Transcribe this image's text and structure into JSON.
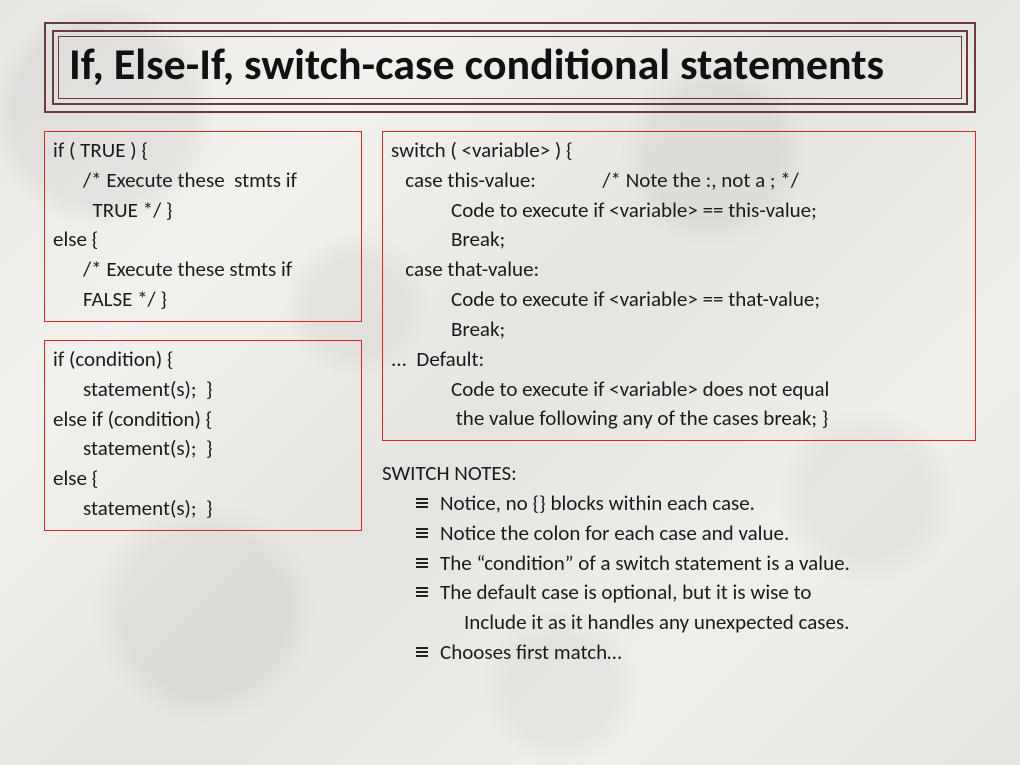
{
  "title": "If, Else-If, switch-case conditional statements",
  "if_block": {
    "l1": "if ( TRUE ) {",
    "l2": "/* Execute these  stmts if",
    "l3": "TRUE */ }",
    "l4": "else {",
    "l5": "/* Execute these stmts if",
    "l6": "FALSE */ }"
  },
  "elseif_block": {
    "l1": "if (condition) {",
    "l2": "statement(s);  }",
    "l3": "else if (condition) {",
    "l4": "statement(s);  }",
    "l5": "else {",
    "l6": "statement(s);  }"
  },
  "switch_block": {
    "l1": "switch ( <variable> ) {",
    "l2": "case this-value:              /* Note the :, not a ; */",
    "l3": "Code to execute if <variable> == this-value;",
    "l4": "Break;",
    "l5": "case that-value:",
    "l6": "Code to execute if <variable> == that-value;",
    "l7": "Break;",
    "l8": "...  Default:",
    "l9": "Code to execute if <variable> does not equal",
    "l10": " the value following any of the cases break; }"
  },
  "notes": {
    "title": "SWITCH NOTES:",
    "items": [
      "Notice, no {} blocks within each case.",
      "Notice the colon for each case and value.",
      "The “condition” of a switch statement is a value.",
      "The default case is optional, but it is wise to",
      "Chooses first match…"
    ],
    "item4_cont": "Include it as it handles any unexpected cases."
  }
}
